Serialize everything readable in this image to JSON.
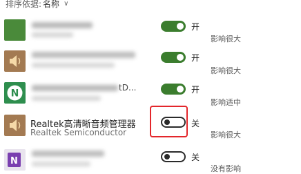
{
  "sort": {
    "label": "排序依据:",
    "value": "名称"
  },
  "apps": [
    {
      "name": "",
      "publisher": "",
      "toggle_on": true,
      "state": "开",
      "impact": "影响很大",
      "icon": "green-square-icon"
    },
    {
      "name": "",
      "publisher": "",
      "toggle_on": true,
      "state": "开",
      "impact": "影响很大",
      "icon": "speaker-icon"
    },
    {
      "name": "",
      "publisher": "",
      "name_tail": "tD...",
      "toggle_on": true,
      "state": "开",
      "impact": "影响适中",
      "icon": "n-logo-icon"
    },
    {
      "name": "Realtek高清晰音频管理器",
      "publisher": "Realtek Semiconductor",
      "toggle_on": false,
      "state": "关",
      "impact": "影响很大",
      "icon": "speaker-icon"
    },
    {
      "name": "",
      "publisher": "",
      "toggle_on": false,
      "state": "关",
      "impact": "没有影响",
      "icon": "onenote-icon"
    }
  ],
  "colors": {
    "toggle_on": "#3b7d2e",
    "highlight": "#e3262b"
  }
}
